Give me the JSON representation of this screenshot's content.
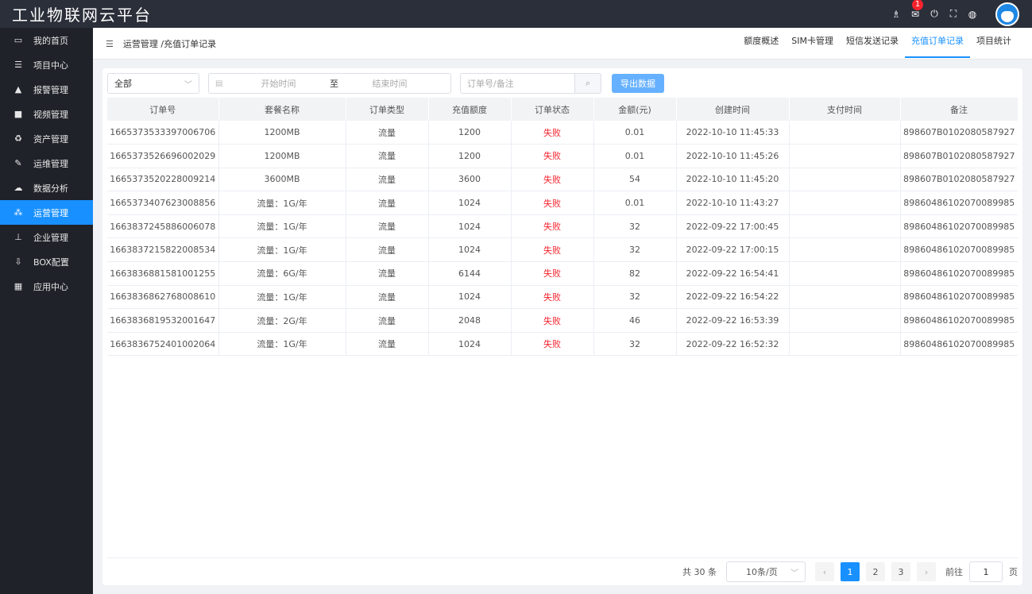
{
  "app": {
    "title": "工业物联网云平台"
  },
  "topbar": {
    "notification_count": "1",
    "icons": [
      "menu-tree-icon",
      "mail-icon",
      "power-icon",
      "fullscreen-icon",
      "globe-icon"
    ]
  },
  "sidebar": {
    "items": [
      {
        "label": "我的首页",
        "icon": "laptop-icon",
        "glyph": "▭"
      },
      {
        "label": "项目中心",
        "icon": "list-icon",
        "glyph": "☰"
      },
      {
        "label": "报警管理",
        "icon": "bell-icon",
        "glyph": "▲"
      },
      {
        "label": "视频管理",
        "icon": "video-icon",
        "glyph": "■"
      },
      {
        "label": "资产管理",
        "icon": "recycle-icon",
        "glyph": "♻"
      },
      {
        "label": "运维管理",
        "icon": "wrench-icon",
        "glyph": "✎"
      },
      {
        "label": "数据分析",
        "icon": "cloud-icon",
        "glyph": "☁"
      },
      {
        "label": "运营管理",
        "icon": "cubes-icon",
        "glyph": "⁂",
        "active": true
      },
      {
        "label": "企业管理",
        "icon": "sitemap-icon",
        "glyph": "⊥"
      },
      {
        "label": "BOX配置",
        "icon": "download-icon",
        "glyph": "⇩"
      },
      {
        "label": "应用中心",
        "icon": "apps-icon",
        "glyph": "▦"
      }
    ]
  },
  "header": {
    "breadcrumb": "运营管理 /充值订单记录",
    "tabs": [
      {
        "label": "额度概述"
      },
      {
        "label": "SIM卡管理"
      },
      {
        "label": "短信发送记录"
      },
      {
        "label": "充值订单记录",
        "active": true
      },
      {
        "label": "项目统计"
      }
    ]
  },
  "filters": {
    "status_select": "全部",
    "start_placeholder": "开始时间",
    "range_separator": "至",
    "end_placeholder": "结束时间",
    "search_placeholder": "订单号/备注",
    "export_label": "导出数据"
  },
  "table": {
    "columns": [
      "订单号",
      "套餐名称",
      "订单类型",
      "充值额度",
      "订单状态",
      "金额(元)",
      "创建时间",
      "支付时间",
      "备注"
    ],
    "rows": [
      [
        "1665373533397006706",
        "1200MB",
        "流量",
        "1200",
        "失败",
        "0.01",
        "2022-10-10 11:45:33",
        "",
        "898607B0102080587927"
      ],
      [
        "1665373526696002029",
        "1200MB",
        "流量",
        "1200",
        "失败",
        "0.01",
        "2022-10-10 11:45:26",
        "",
        "898607B0102080587927"
      ],
      [
        "1665373520228009214",
        "3600MB",
        "流量",
        "3600",
        "失败",
        "54",
        "2022-10-10 11:45:20",
        "",
        "898607B0102080587927"
      ],
      [
        "1665373407623008856",
        "流量：1G/年",
        "流量",
        "1024",
        "失败",
        "0.01",
        "2022-10-10 11:43:27",
        "",
        "89860486102070089985"
      ],
      [
        "1663837245886006078",
        "流量：1G/年",
        "流量",
        "1024",
        "失败",
        "32",
        "2022-09-22 17:00:45",
        "",
        "89860486102070089985"
      ],
      [
        "1663837215822008534",
        "流量：1G/年",
        "流量",
        "1024",
        "失败",
        "32",
        "2022-09-22 17:00:15",
        "",
        "89860486102070089985"
      ],
      [
        "1663836881581001255",
        "流量：6G/年",
        "流量",
        "6144",
        "失败",
        "82",
        "2022-09-22 16:54:41",
        "",
        "89860486102070089985"
      ],
      [
        "1663836862768008610",
        "流量：1G/年",
        "流量",
        "1024",
        "失败",
        "32",
        "2022-09-22 16:54:22",
        "",
        "89860486102070089985"
      ],
      [
        "1663836819532001647",
        "流量：2G/年",
        "流量",
        "2048",
        "失败",
        "46",
        "2022-09-22 16:53:39",
        "",
        "89860486102070089985"
      ],
      [
        "1663836752401002064",
        "流量：1G/年",
        "流量",
        "1024",
        "失败",
        "32",
        "2022-09-22 16:52:32",
        "",
        "89860486102070089985"
      ]
    ]
  },
  "pagination": {
    "total": "共 30 条",
    "page_size": "10条/页",
    "pages": [
      "1",
      "2",
      "3"
    ],
    "current_page": "1",
    "goto_label": "前往",
    "goto_value": "1",
    "page_unit": "页"
  },
  "colors": {
    "accent": "#1890ff",
    "fail": "#f5222d",
    "sidebar_bg": "#1f2229",
    "topbar_bg": "#2b2f3a"
  }
}
